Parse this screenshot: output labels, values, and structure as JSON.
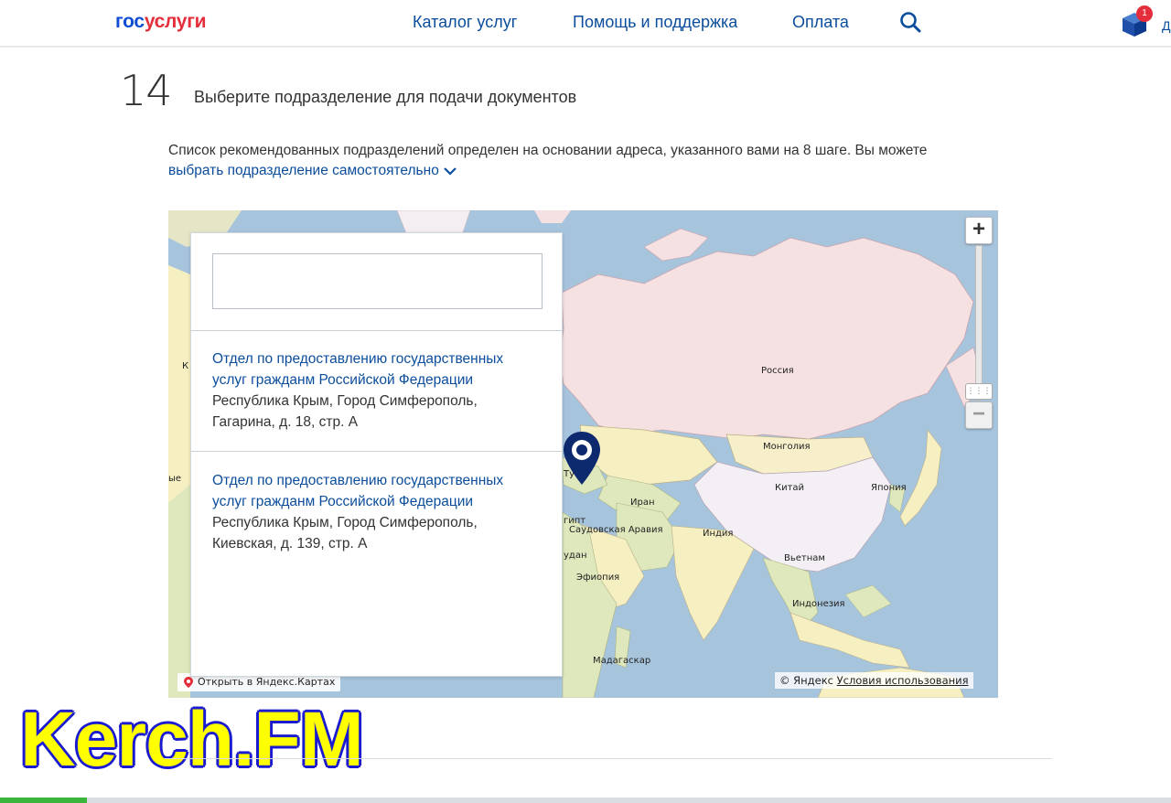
{
  "header": {
    "logo_part1": "гос",
    "logo_part2": "услуги",
    "nav": [
      {
        "label": "Каталог услуг"
      },
      {
        "label": "Помощь и поддержка"
      },
      {
        "label": "Оплата"
      }
    ],
    "cart_count": "1",
    "edge_char": "Д"
  },
  "step": {
    "number": "14",
    "title": "Выберите подразделение для подачи документов",
    "description": "Список рекомендованных подразделений определен на основании адреса, указанного вами на 8 шаге. Вы можете",
    "self_select_link": "выбрать подразделение самостоятельно"
  },
  "map": {
    "search_value": "",
    "items": [
      {
        "title_line1": "Отдел по предоставлению государственных",
        "title_line2": "услуг гражданм Российской Федерации",
        "addr_line1": "Республика Крым, Город Симферополь,",
        "addr_line2": "Гагарина, д. 18, стр. А"
      },
      {
        "title_line1": "Отдел по предоставлению государственных",
        "title_line2": "услуг гражданм Российской Федерации",
        "addr_line1": "Республика Крым, Город Симферополь,",
        "addr_line2": "Киевская, д. 139, стр. А"
      }
    ],
    "labels": {
      "russia": "Россия",
      "mongolia": "Монголия",
      "china": "Китай",
      "japan": "Япония",
      "iran": "Иран",
      "india": "Индия",
      "saudi": "Саудовская Аравия",
      "vietnam": "Вьетнам",
      "indonesia": "Индонезия",
      "ethiopia": "Эфиопия",
      "sudan": "удан",
      "madagascar": "Мадагаскар",
      "turkey": "Ту",
      "egypt": "гипт",
      "edge_k": "К",
      "edge_ye": "ые"
    },
    "open_in_yandex": "Открыть в Яндекс.Картах",
    "copyright": "© Яндекс",
    "terms_link": "Условия использования",
    "zoom_in": "+",
    "zoom_out": "−"
  },
  "watermark": "Kerch.FM",
  "colors": {
    "link": "#0b4d9c",
    "water": "#a7c4dd",
    "russia": "#f5e0e2",
    "china": "#f4eef5",
    "mongolia": "#f7efc9",
    "land_green": "#dfe8bd",
    "land_yellow": "#f6efc2",
    "pin": "#0d2a6e",
    "watermark_fill": "#ffff00",
    "watermark_outline": "#1b1bd0"
  }
}
